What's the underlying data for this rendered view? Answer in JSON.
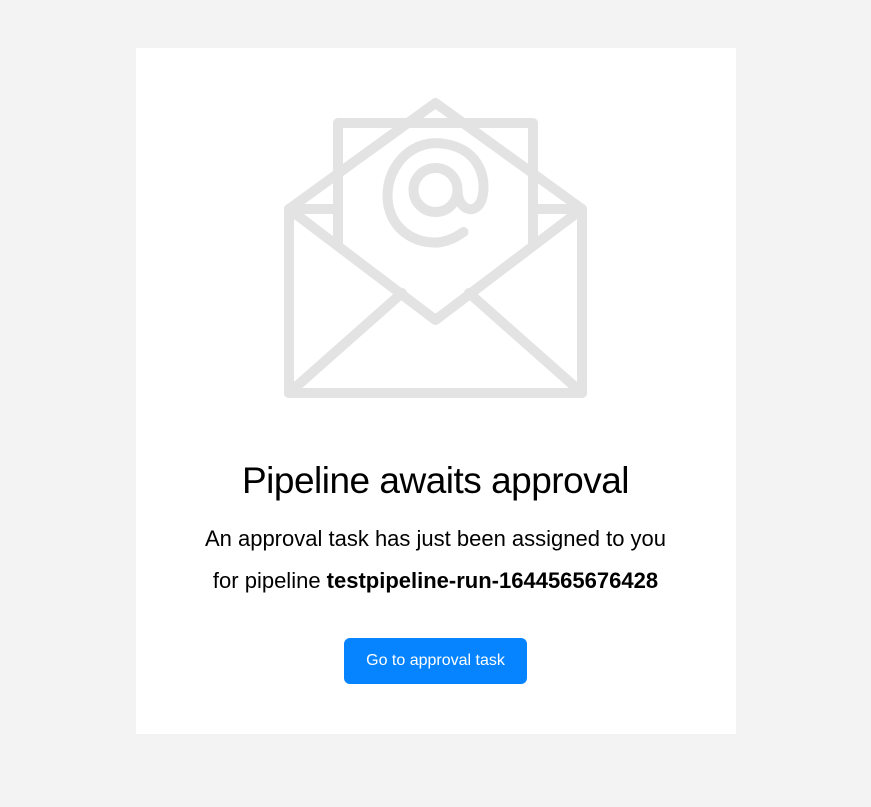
{
  "card": {
    "title": "Pipeline awaits approval",
    "subtitle_line1": "An approval task has just been assigned to you",
    "subtitle_line2_prefix": "for pipeline ",
    "pipeline_name": "testpipeline-run-1644565676428",
    "action_label": "Go to approval task"
  }
}
